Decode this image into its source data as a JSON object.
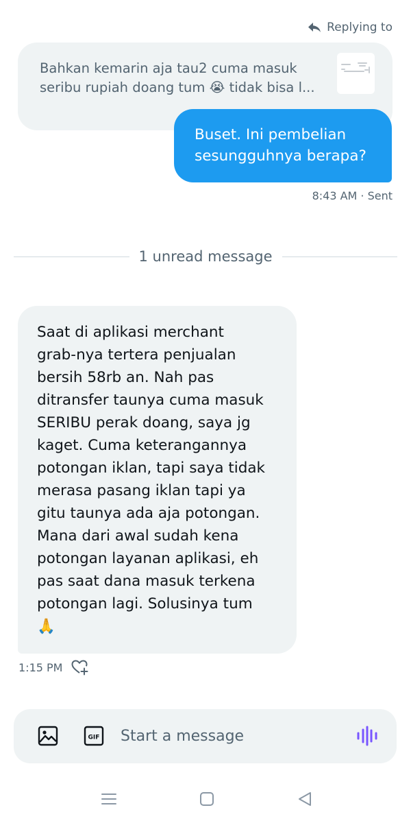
{
  "header": {
    "replying_label": "Replying to"
  },
  "quoted_message": {
    "lines": [
      "Bahkan kemarin aja tau2 cuma masuk",
      "seribu rupiah doang tum 😭 tidak bisa l..."
    ]
  },
  "sent_message": {
    "lines": [
      "Buset. Ini pembelian",
      "sesungguhnya berapa?"
    ],
    "meta": "8:43 AM · Sent",
    "color": "#1d9bf0"
  },
  "divider": {
    "label": "1 unread message"
  },
  "received_message": {
    "lines": [
      "Saat di aplikasi merchant",
      "grab-nya tertera penjualan",
      "bersih 58rb an. Nah pas",
      "ditransfer taunya cuma masuk",
      "SERIBU perak doang, saya jg",
      "kaget. Cuma keterangannya",
      "potongan iklan, tapi saya tidak",
      "merasa pasang iklan tapi ya",
      "gitu taunya ada aja potongan.",
      "Mana dari awal sudah kena",
      "potongan layanan aplikasi, eh",
      "pas saat dana masuk terkena",
      "potongan lagi. Solusinya tum",
      "🙏"
    ],
    "time": "1:15 PM"
  },
  "composer": {
    "placeholder": "Start a message",
    "icons": [
      "image-icon",
      "gif-icon",
      "voice-icon"
    ],
    "accent_color": "#7856ff"
  },
  "system_nav": {
    "icons": [
      "recents-icon",
      "home-icon",
      "back-icon"
    ]
  }
}
